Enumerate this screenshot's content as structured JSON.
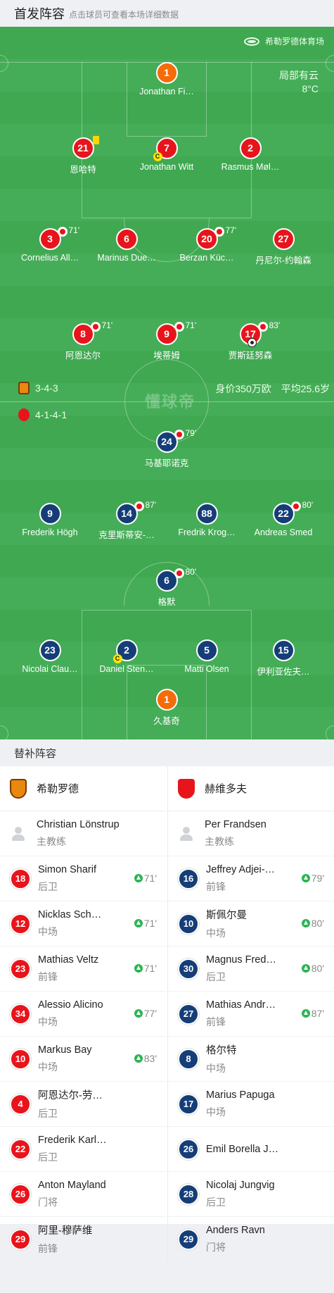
{
  "header": {
    "title": "首发阵容",
    "subtitle": "点击球员可查看本场详细数据"
  },
  "venue": {
    "name": "希勒罗德体育场",
    "icon": "stadium-icon"
  },
  "weather": {
    "condition": "局部有云",
    "temp": "8°C"
  },
  "home_team": {
    "formation": "3-4-3",
    "color": "#e8141b",
    "players": [
      {
        "num": "1",
        "name": "Jonathan Fi…",
        "kit": "orange"
      },
      {
        "num": "21",
        "name": "恩哈特",
        "kit": "red",
        "yellow": true
      },
      {
        "num": "7",
        "name": "Jonathan Witt",
        "kit": "red",
        "captain": true
      },
      {
        "num": "2",
        "name": "Rasmus Møl…",
        "kit": "red"
      },
      {
        "num": "3",
        "name": "Cornelius All…",
        "kit": "red",
        "sub": "71'"
      },
      {
        "num": "6",
        "name": "Marinus Due…",
        "kit": "red"
      },
      {
        "num": "20",
        "name": "Berzan Küc…",
        "kit": "red",
        "sub": "77'"
      },
      {
        "num": "27",
        "name": "丹尼尔-约翰森",
        "kit": "red"
      },
      {
        "num": "8",
        "name": "阿恩达尔",
        "kit": "red",
        "sub": "71'"
      },
      {
        "num": "9",
        "name": "埃蒂姆",
        "kit": "red",
        "sub": "71'"
      },
      {
        "num": "17",
        "name": "贾斯廷努森",
        "kit": "red",
        "sub": "83'",
        "goal": true
      }
    ]
  },
  "away_team": {
    "formation": "4-1-4-1",
    "color": "#153e78",
    "players": [
      {
        "num": "24",
        "name": "马基耶诺克",
        "kit": "blue",
        "sub": "79'"
      },
      {
        "num": "9",
        "name": "Frederik Högh",
        "kit": "blue"
      },
      {
        "num": "14",
        "name": "克里斯蒂安-…",
        "kit": "blue",
        "sub": "87'"
      },
      {
        "num": "88",
        "name": "Fredrik Krog…",
        "kit": "blue"
      },
      {
        "num": "22",
        "name": "Andreas Smed",
        "kit": "blue",
        "sub": "80'"
      },
      {
        "num": "6",
        "name": "格默",
        "kit": "blue",
        "sub": "80'"
      },
      {
        "num": "23",
        "name": "Nicolai Clau…",
        "kit": "blue"
      },
      {
        "num": "2",
        "name": "Daniel Sten…",
        "kit": "blue",
        "captain": true
      },
      {
        "num": "5",
        "name": "Matti Olsen",
        "kit": "blue"
      },
      {
        "num": "15",
        "name": "伊利亚佐夫…",
        "kit": "blue"
      },
      {
        "num": "1",
        "name": "久基奇",
        "kit": "orange"
      }
    ]
  },
  "mid_stats": {
    "value": "身价350万欧",
    "age": "平均25.6岁"
  },
  "watermark": "懂球帝",
  "subs": {
    "title": "替补阵容",
    "home": {
      "team": "希勒罗德",
      "coach": {
        "name": "Christian Lönstrup",
        "role": "主教练"
      },
      "players": [
        {
          "num": "18",
          "name": "Simon Sharif",
          "pos": "后卫",
          "in": "71'"
        },
        {
          "num": "12",
          "name": "Nicklas Sch…",
          "pos": "中场",
          "in": "71'"
        },
        {
          "num": "23",
          "name": "Mathias Veltz",
          "pos": "前锋",
          "in": "71'"
        },
        {
          "num": "34",
          "name": "Alessio Alicino",
          "pos": "中场",
          "in": "77'"
        },
        {
          "num": "10",
          "name": "Markus Bay",
          "pos": "中场",
          "in": "83'"
        },
        {
          "num": "4",
          "name": "阿恩达尔-劳…",
          "pos": "后卫",
          "in": ""
        },
        {
          "num": "22",
          "name": "Frederik Karl…",
          "pos": "后卫",
          "in": ""
        },
        {
          "num": "26",
          "name": "Anton Mayland",
          "pos": "门将",
          "in": ""
        },
        {
          "num": "29",
          "name": "阿里-穆萨维",
          "pos": "前锋",
          "in": ""
        }
      ]
    },
    "away": {
      "team": "赫维多夫",
      "coach": {
        "name": "Per Frandsen",
        "role": "主教练"
      },
      "players": [
        {
          "num": "16",
          "name": "Jeffrey Adjei-…",
          "pos": "前锋",
          "in": "79'"
        },
        {
          "num": "10",
          "name": "斯佩尔曼",
          "pos": "中场",
          "in": "80'"
        },
        {
          "num": "30",
          "name": "Magnus Fred…",
          "pos": "后卫",
          "in": "80'"
        },
        {
          "num": "27",
          "name": "Mathias Andr…",
          "pos": "前锋",
          "in": "87'"
        },
        {
          "num": "8",
          "name": "格尔特",
          "pos": "中场",
          "in": ""
        },
        {
          "num": "17",
          "name": "Marius Papuga",
          "pos": "中场",
          "in": ""
        },
        {
          "num": "26",
          "name": "Emil Borella J…",
          "pos": "",
          "in": ""
        },
        {
          "num": "28",
          "name": "Nicolaj Jungvig",
          "pos": "后卫",
          "in": ""
        },
        {
          "num": "29",
          "name": "Anders Ravn",
          "pos": "门将",
          "in": ""
        }
      ]
    }
  }
}
